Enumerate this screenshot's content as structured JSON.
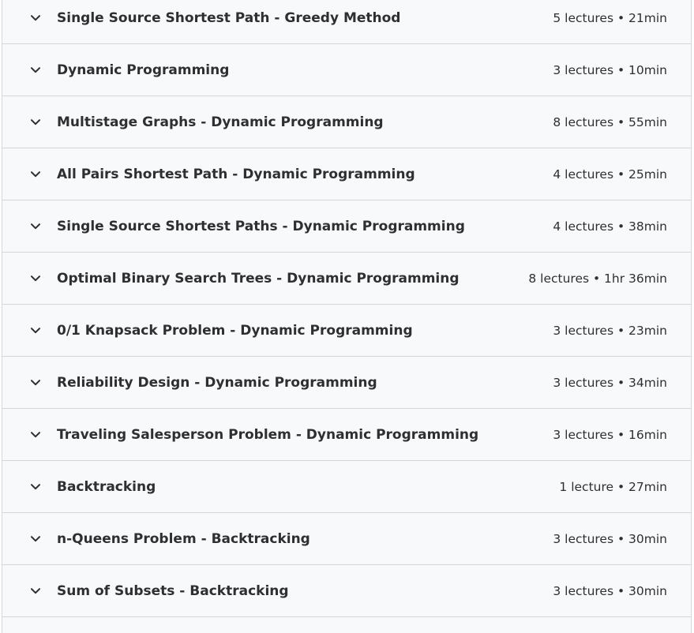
{
  "sections": [
    {
      "title": "Single Source Shortest Path - Greedy Method",
      "meta": "5 lectures • 21min"
    },
    {
      "title": "Dynamic Programming",
      "meta": "3 lectures • 10min"
    },
    {
      "title": "Multistage Graphs - Dynamic Programming",
      "meta": "8 lectures • 55min"
    },
    {
      "title": "All Pairs Shortest Path - Dynamic Programming",
      "meta": "4 lectures • 25min"
    },
    {
      "title": "Single Source Shortest Paths - Dynamic Programming",
      "meta": "4 lectures • 38min"
    },
    {
      "title": "Optimal Binary Search Trees - Dynamic Programming",
      "meta": "8 lectures • 1hr 36min"
    },
    {
      "title": "0/1 Knapsack Problem - Dynamic Programming",
      "meta": "3 lectures • 23min"
    },
    {
      "title": "Reliability Design - Dynamic Programming",
      "meta": "3 lectures • 34min"
    },
    {
      "title": "Traveling Salesperson Problem - Dynamic Programming",
      "meta": "3 lectures • 16min"
    },
    {
      "title": "Backtracking",
      "meta": "1 lecture • 27min"
    },
    {
      "title": "n-Queens Problem - Backtracking",
      "meta": "3 lectures • 30min"
    },
    {
      "title": "Sum of Subsets - Backtracking",
      "meta": "3 lectures • 30min"
    }
  ],
  "icons": {
    "expand": "chevron-down-icon"
  },
  "colors": {
    "section_bg": "#f7f9fa",
    "border": "#d1d7dc",
    "text": "#2d2f31"
  }
}
